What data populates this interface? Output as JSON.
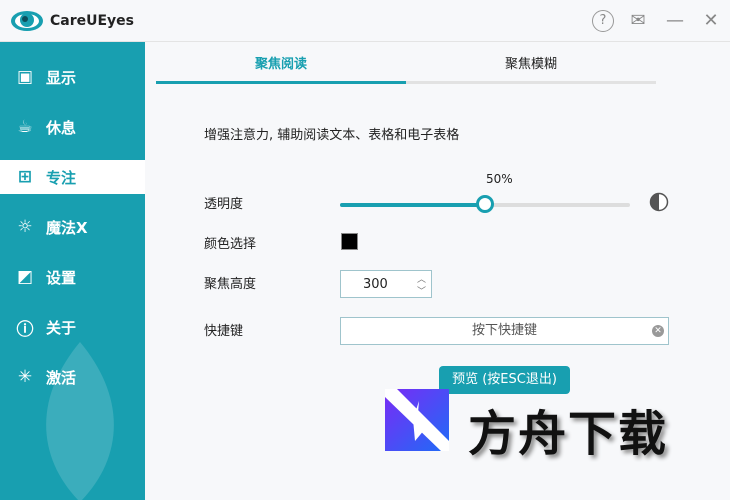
{
  "app": {
    "title": "CareUEyes"
  },
  "titlebar": {
    "help": "?",
    "feedback": "✉",
    "minimize": "—",
    "close": "✕"
  },
  "sidebar": {
    "items": [
      {
        "label": "显示",
        "icon": "monitor-icon",
        "glyph": "▣"
      },
      {
        "label": "休息",
        "icon": "coffee-icon",
        "glyph": "☕"
      },
      {
        "label": "专注",
        "icon": "windows-icon",
        "glyph": "⊞"
      },
      {
        "label": "魔法X",
        "icon": "sun-icon",
        "glyph": "☼"
      },
      {
        "label": "设置",
        "icon": "settings-icon",
        "glyph": "◩"
      },
      {
        "label": "关于",
        "icon": "info-icon",
        "glyph": "ⓘ"
      },
      {
        "label": "激活",
        "icon": "sparkle-icon",
        "glyph": "✳"
      }
    ],
    "active": 2
  },
  "tabs": [
    {
      "label": "聚焦阅读",
      "active": true
    },
    {
      "label": "聚焦模糊",
      "active": false
    }
  ],
  "main": {
    "description": "增强注意力, 辅助阅读文本、表格和电子表格",
    "opacity_label": "透明度",
    "opacity_value_text": "50%",
    "opacity": 0.5,
    "color_label": "颜色选择",
    "color": "#000000",
    "height_label": "聚焦高度",
    "height_value": "300",
    "hotkey_label": "快捷键",
    "hotkey_placeholder": "按下快捷键",
    "preview_button": "预览 (按ESC退出)"
  },
  "watermark": {
    "text": "方舟下载"
  },
  "colors": {
    "accent": "#189fb0"
  }
}
